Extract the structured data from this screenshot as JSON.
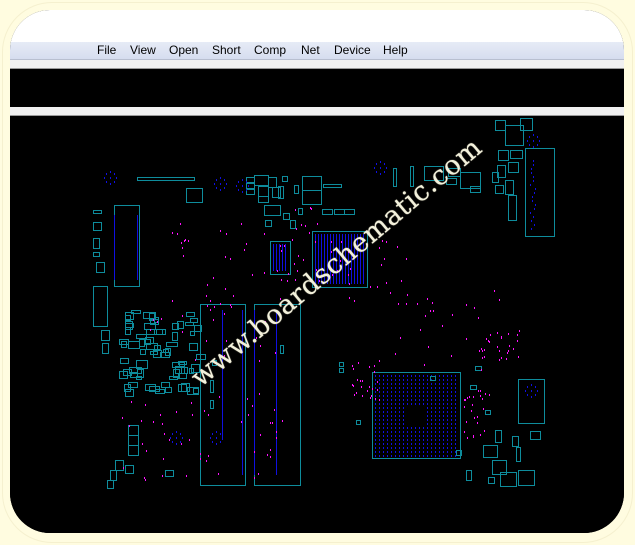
{
  "app": {
    "menu": [
      {
        "label": "File"
      },
      {
        "label": "View"
      },
      {
        "label": "Open"
      },
      {
        "label": "Short"
      },
      {
        "label": "Comp"
      },
      {
        "label": "Net"
      },
      {
        "label": "Device"
      },
      {
        "label": "Help"
      }
    ]
  },
  "board": {
    "watermark": "www.boardschematic.com",
    "colors": {
      "outline": "#0e8c9c",
      "pad": "#1010e0",
      "testpoint": "#ff10ff",
      "background": "#000000"
    }
  }
}
